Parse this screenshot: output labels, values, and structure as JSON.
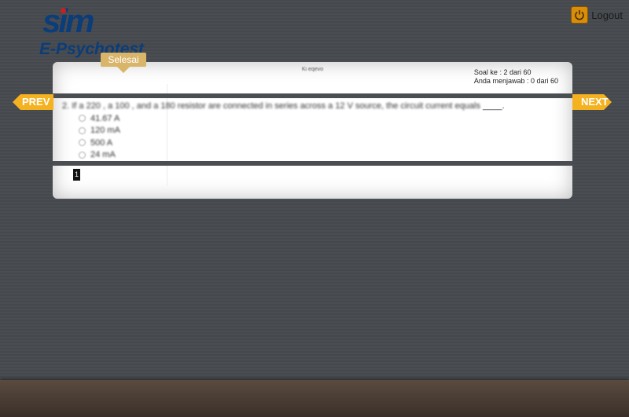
{
  "brand": {
    "mark": "sim",
    "subtitle": "E-Psychotest"
  },
  "header": {
    "logout_label": "Logout"
  },
  "finish_button": "Selesai",
  "panel": {
    "title": "Ki eqevo",
    "progress_line1": "Soal ke : 2 dari 60",
    "progress_line2": "Anda menjawab : 0 dari 60"
  },
  "question": {
    "text": "2. If a 220 , a 100 , and a 180 resistor are connected in series across a 12 V source, the circuit current equals",
    "blank": "____."
  },
  "options": [
    "41.67 A",
    "120 mA",
    "500 A",
    "24 mA"
  ],
  "pagination": {
    "pages": [
      "1"
    ]
  },
  "nav": {
    "prev": "PREV",
    "next": "NEXT"
  },
  "colors": {
    "accent": "#f5b220",
    "brand_blue": "#0a3d7a",
    "logout_icon": "#d88e0a"
  }
}
